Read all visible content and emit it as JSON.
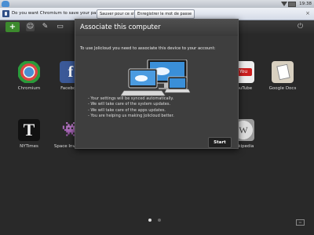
{
  "sysbar": {
    "clock": "19:38"
  },
  "infobar": {
    "message": "Do you want Chromium to save your password?",
    "save_button": "Sauver pour ce site",
    "never_button": "Enregistrer le mot de passe",
    "close": "×"
  },
  "toolbar": {
    "add_label": "+"
  },
  "apps": [
    {
      "label": "Chromium"
    },
    {
      "label": "Facebook",
      "glyph": "f"
    },
    {
      "label": "YouTube",
      "glyph": "You"
    },
    {
      "label": "Google Docs"
    },
    {
      "label": "NYTimes",
      "glyph": "T"
    },
    {
      "label": "Space Invaders",
      "glyph": "👾"
    },
    {
      "label": "Wikipedia",
      "glyph": "W"
    }
  ],
  "modal": {
    "title": "Associate this computer",
    "intro": "To use Jolicloud you need to associate this device to your account:",
    "bullets": [
      "- Your settings will be synced automatically.",
      "- We will take care of the system updates.",
      "- We will take care of the apps updates.",
      "- You are helping us making Jolicloud better."
    ],
    "start_button": "Start"
  },
  "colors": {
    "accent": "#3c8a2d",
    "brand_blue": "#4a8fd3"
  }
}
